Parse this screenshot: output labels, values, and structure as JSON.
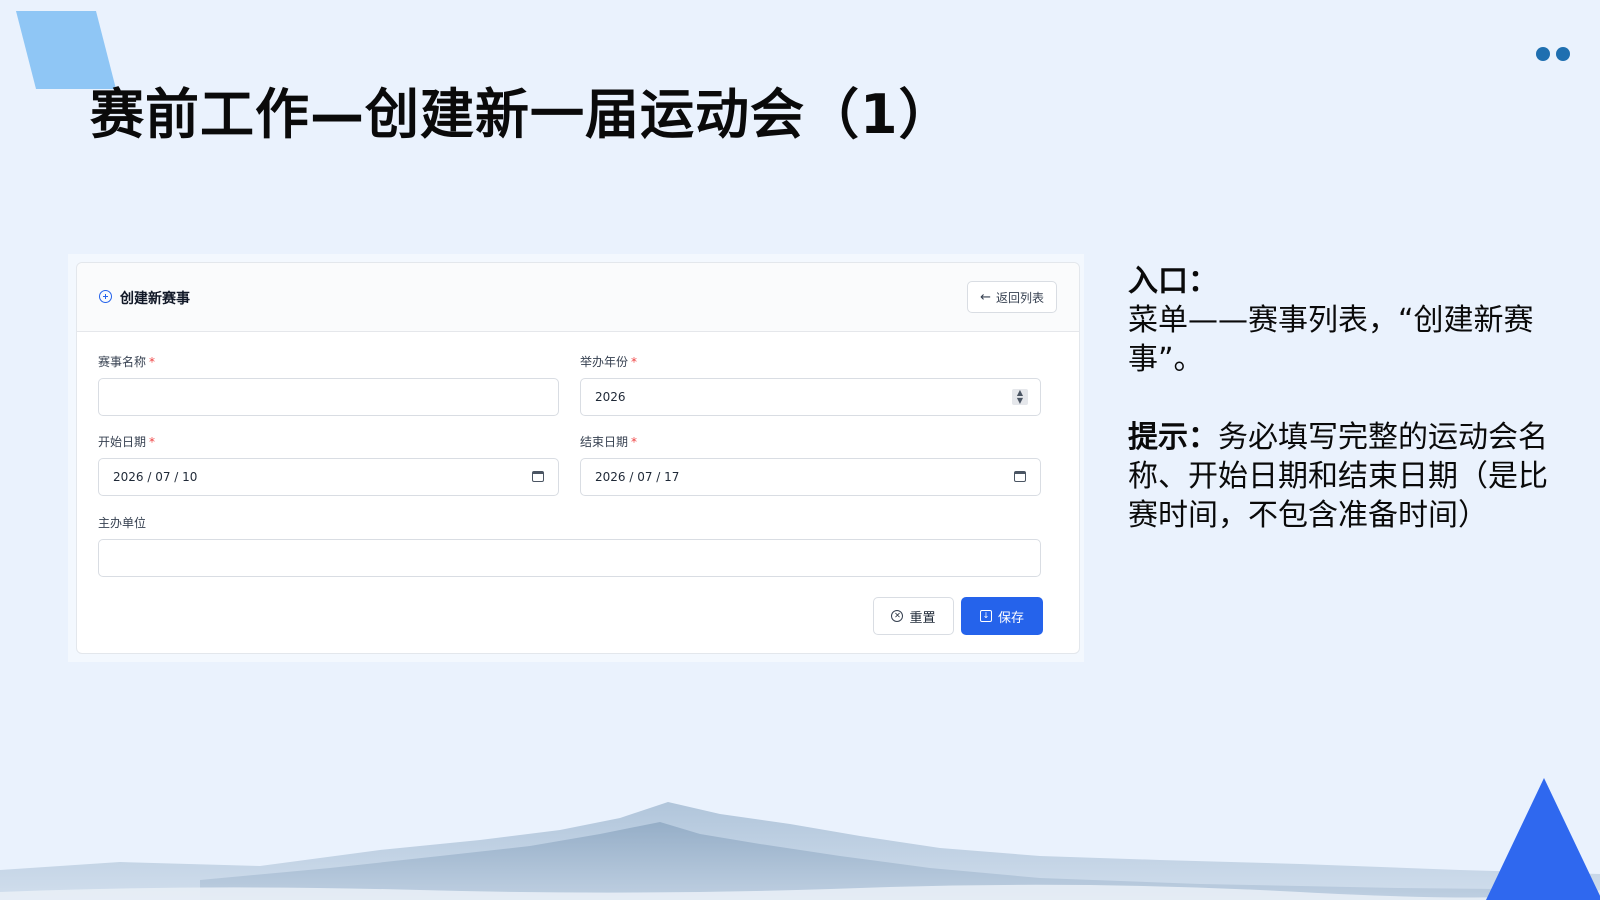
{
  "slide": {
    "title": "赛前工作—创建新一届运动会（1）"
  },
  "form": {
    "header_title": "创建新赛事",
    "back_label": "返回列表",
    "required_mark": "*",
    "fields": {
      "name": {
        "label": "赛事名称",
        "value": ""
      },
      "year": {
        "label": "举办年份",
        "value": "2026"
      },
      "start": {
        "label": "开始日期",
        "value": "2026 / 07 / 10"
      },
      "end": {
        "label": "结束日期",
        "value": "2026 / 07 / 17"
      },
      "host": {
        "label": "主办单位",
        "value": ""
      }
    },
    "reset_label": "重置",
    "save_label": "保存"
  },
  "notes": {
    "entry_heading": "入口：",
    "entry_text": "菜单——赛事列表，“创建新赛事”。",
    "tip_heading": "提示：",
    "tip_text": "务必填写完整的运动会名称、开始日期和结束日期（是比赛时间，不包含准备时间）"
  },
  "colors": {
    "accent": "#2563eb",
    "background": "#eaf2fd",
    "required": "#ef4444"
  }
}
